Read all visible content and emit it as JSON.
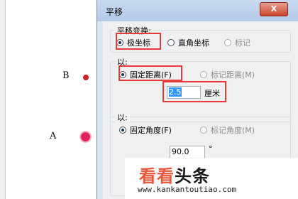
{
  "canvas": {
    "points": [
      {
        "label": "B",
        "color": "#cc2222"
      },
      {
        "label": "A",
        "color": "#e2225f"
      }
    ]
  },
  "dialog": {
    "title": "平移",
    "close_label": "X",
    "translation_group": {
      "title": "平移变换:",
      "options": [
        {
          "label": "极坐标",
          "selected": true,
          "enabled": true
        },
        {
          "label": "直角坐标",
          "selected": false,
          "enabled": true
        },
        {
          "label": "标记",
          "selected": false,
          "enabled": false
        }
      ]
    },
    "distance_group": {
      "title": "以:",
      "options": [
        {
          "label": "固定距离(F)",
          "selected": true,
          "enabled": true
        },
        {
          "label": "标记距离(M)",
          "selected": false,
          "enabled": false
        }
      ],
      "value": "2.5",
      "unit": "厘米"
    },
    "angle_group": {
      "title": "以:",
      "options": [
        {
          "label": "固定角度(F)",
          "selected": true,
          "enabled": true
        },
        {
          "label": "标记角度(M)",
          "selected": false,
          "enabled": false
        }
      ],
      "value": "90.0",
      "unit": "°"
    }
  },
  "watermark": {
    "title_part1": "看看",
    "title_part2": "头条",
    "url": "www.kankantoutiao.com"
  },
  "colors": {
    "highlight": "#e53b3b",
    "selection": "#3399ff"
  }
}
